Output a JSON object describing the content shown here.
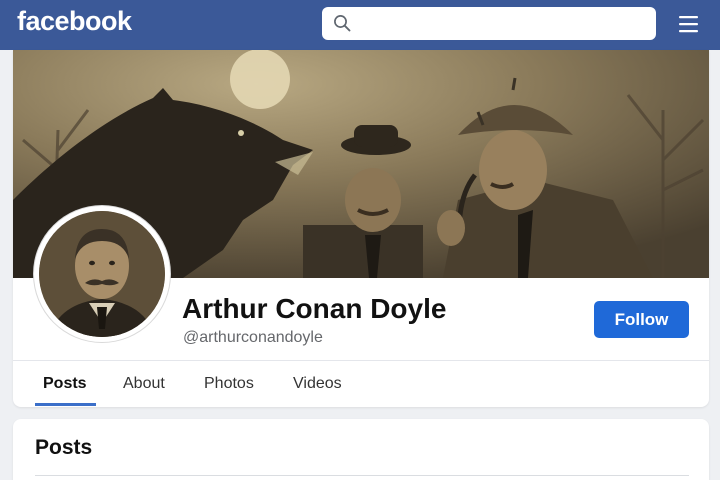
{
  "header": {
    "brand": "facebook",
    "search_placeholder": "",
    "bg_color": "#3b5998"
  },
  "profile": {
    "name": "Arthur Conan Doyle",
    "handle": "@arthurconandoyle",
    "follow_label": "Follow",
    "accent_color": "#1f69d8"
  },
  "tabs": [
    {
      "label": "Posts",
      "active": true
    },
    {
      "label": "About",
      "active": false
    },
    {
      "label": "Photos",
      "active": false
    },
    {
      "label": "Videos",
      "active": false
    }
  ],
  "posts_section": {
    "title": "Posts"
  },
  "icons": {
    "search": "search-icon",
    "menu": "hamburger-menu-icon"
  }
}
